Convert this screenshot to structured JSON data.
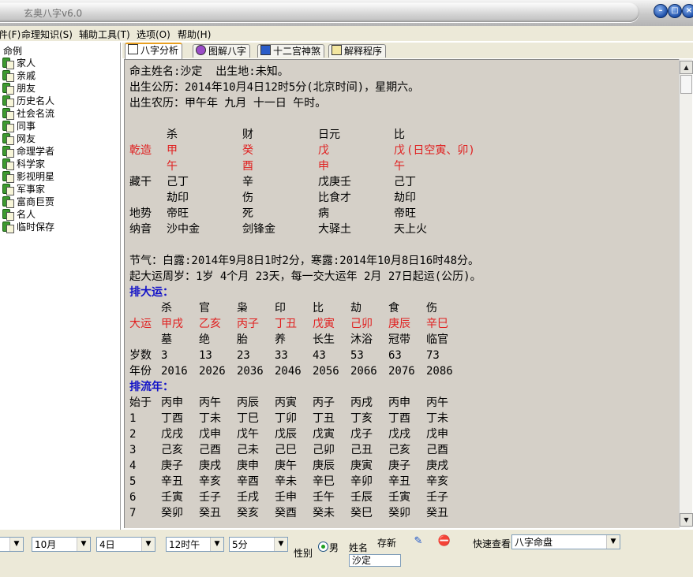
{
  "window": {
    "title": "玄奥八字v6.0"
  },
  "menu": [
    "文件(F)",
    "命理知识(S)",
    "辅助工具(T)",
    "选项(O)",
    "帮助(H)"
  ],
  "tree": {
    "root": "命例",
    "items": [
      "家人",
      "亲戚",
      "朋友",
      "历史名人",
      "社会名流",
      "同事",
      "网友",
      "命理学者",
      "科学家",
      "影视明星",
      "军事家",
      "富商巨贾",
      "名人",
      "临时保存"
    ]
  },
  "tabs": [
    "八字分析",
    "图解八字",
    "十二宫神煞",
    "解释程序"
  ],
  "report": {
    "header": [
      "命主姓名:沙定  出生地:未知。",
      "出生公历：2014年10月4日12时5分(北京时间)，星期六。",
      "出生农历：甲午年 九月 十一日 午时。"
    ],
    "pillars": {
      "ten_gods": [
        "杀",
        "财",
        "日元",
        "比"
      ],
      "label_qianzao": "乾造",
      "stems": [
        "甲",
        "癸",
        "戊",
        "戊"
      ],
      "stem_note": "(日空寅、卯)",
      "branches": [
        "午",
        "酉",
        "申",
        "午"
      ],
      "label_canggan": "藏干",
      "hidden_stems": [
        "己丁",
        "辛",
        "戊庚壬",
        "己丁"
      ],
      "hidden_gods": [
        "劫印",
        "伤",
        "比食才",
        "劫印"
      ],
      "label_dishi": "地势",
      "dishi": [
        "帝旺",
        "死",
        "病",
        "帝旺"
      ],
      "label_nayin": "纳音",
      "nayin": [
        "沙中金",
        "剑锋金",
        "大驿土",
        "天上火"
      ]
    },
    "jieqi": "节气：白露:2014年9月8日1时2分，寒露:2014年10月8日16时48分。",
    "qiyun": "起大运周岁：1岁 4个月 23天，每一交大运年 2月 27日起运(公历)。",
    "dayun": {
      "heading": "排大运：",
      "gods": [
        "杀",
        "官",
        "枭",
        "印",
        "比",
        "劫",
        "食",
        "伤"
      ],
      "label": "大运",
      "pillars": [
        "甲戌",
        "乙亥",
        "丙子",
        "丁丑",
        "戊寅",
        "己卯",
        "庚辰",
        "辛巳"
      ],
      "phases": [
        "墓",
        "绝",
        "胎",
        "养",
        "长生",
        "沐浴",
        "冠带",
        "临官"
      ],
      "age_label": "岁数",
      "ages": [
        "3",
        "13",
        "23",
        "33",
        "43",
        "53",
        "63",
        "73"
      ],
      "year_label": "年份",
      "years": [
        "2016",
        "2026",
        "2036",
        "2046",
        "2056",
        "2066",
        "2076",
        "2086"
      ]
    },
    "liunian": {
      "heading": "排流年：",
      "rows": [
        {
          "label": "始于",
          "cells": [
            "丙申",
            "丙午",
            "丙辰",
            "丙寅",
            "丙子",
            "丙戌",
            "丙申",
            "丙午"
          ]
        },
        {
          "label": "1",
          "cells": [
            "丁酉",
            "丁未",
            "丁巳",
            "丁卯",
            "丁丑",
            "丁亥",
            "丁酉",
            "丁未"
          ]
        },
        {
          "label": "2",
          "cells": [
            "戊戌",
            "戊申",
            "戊午",
            "戊辰",
            "戊寅",
            "戊子",
            "戊戌",
            "戊申"
          ]
        },
        {
          "label": "3",
          "cells": [
            "己亥",
            "己酉",
            "己未",
            "己巳",
            "己卯",
            "己丑",
            "己亥",
            "己酉"
          ]
        },
        {
          "label": "4",
          "cells": [
            "庚子",
            "庚戌",
            "庚申",
            "庚午",
            "庚辰",
            "庚寅",
            "庚子",
            "庚戌"
          ]
        },
        {
          "label": "5",
          "cells": [
            "辛丑",
            "辛亥",
            "辛酉",
            "辛未",
            "辛巳",
            "辛卯",
            "辛丑",
            "辛亥"
          ]
        },
        {
          "label": "6",
          "cells": [
            "壬寅",
            "壬子",
            "壬戌",
            "壬申",
            "壬午",
            "壬辰",
            "壬寅",
            "壬子"
          ]
        },
        {
          "label": "7",
          "cells": [
            "癸卯",
            "癸丑",
            "癸亥",
            "癸酉",
            "癸未",
            "癸巳",
            "癸卯",
            "癸丑"
          ]
        }
      ]
    }
  },
  "bottom": {
    "month": "10月",
    "day": "4日",
    "hour": "12时午",
    "minute": "5分",
    "gender_label": "性别",
    "gender_value": "男",
    "name_label": "姓名",
    "name_value": "沙定",
    "save_label": "存新",
    "quickview_label": "快速查看",
    "quickview_value": "八字命盘"
  },
  "colors": {
    "accent_red": "#e02020",
    "heading_blue": "#1010c8",
    "pane_bg": "#d5d0c8"
  }
}
